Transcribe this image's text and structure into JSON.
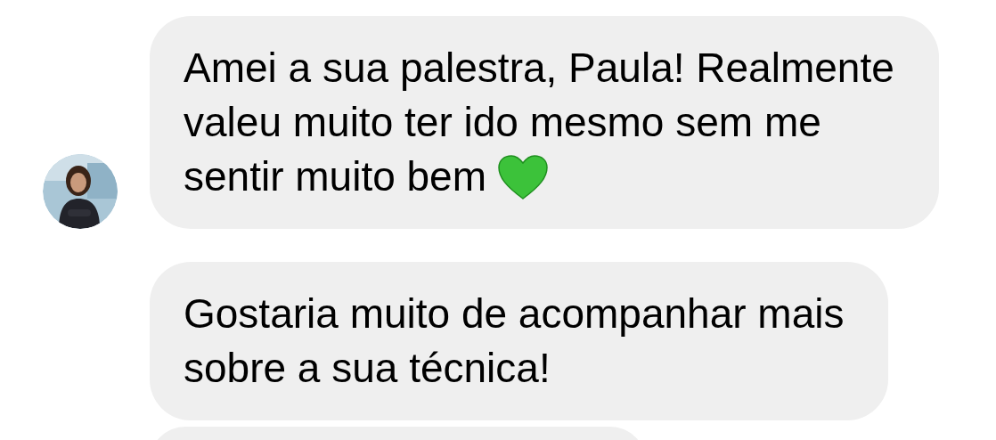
{
  "messages": [
    {
      "lines": [
        "Amei a sua palestra, Paula! Realmente",
        "valeu muito ter ido mesmo sem me",
        "sentir muito bem"
      ],
      "heart_after": true,
      "show_avatar": true
    },
    {
      "lines": [
        "Gostaria muito de acompanhar mais",
        "sobre a sua técnica!"
      ],
      "heart_after": false,
      "show_avatar": false
    }
  ]
}
